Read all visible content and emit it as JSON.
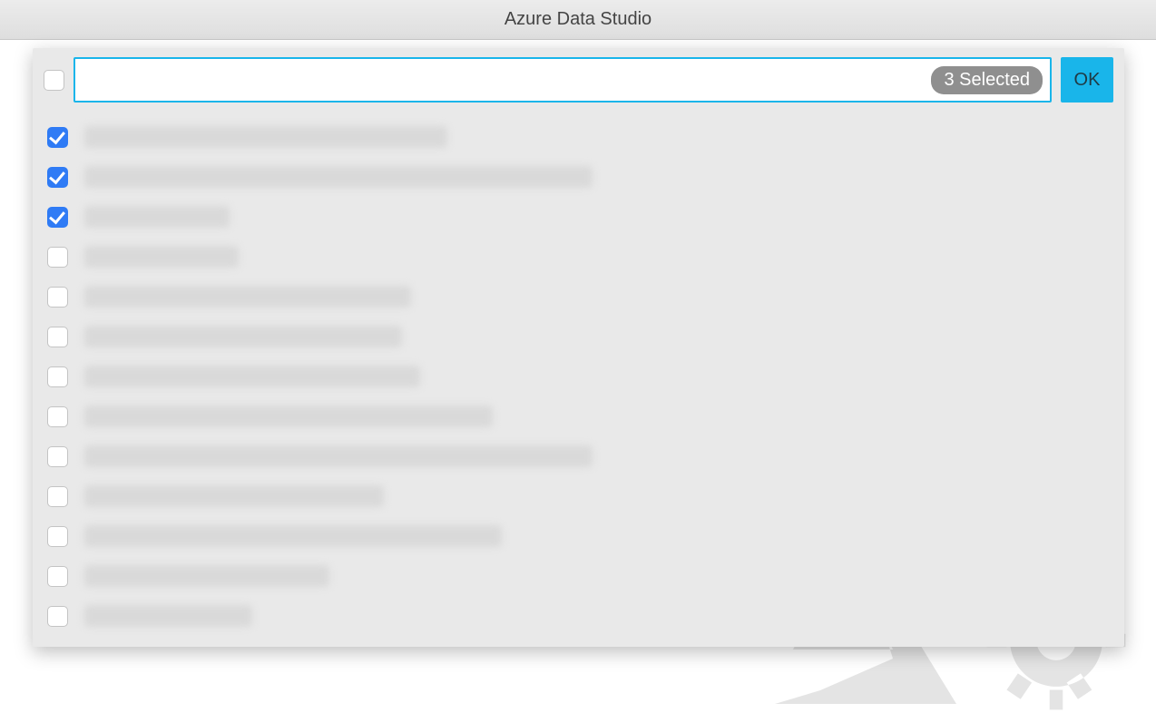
{
  "window": {
    "title": "Azure Data Studio"
  },
  "picker": {
    "search_value": "",
    "search_placeholder": "",
    "selected_badge": "3 Selected",
    "ok_label": "OK",
    "select_all_checked": false,
    "items": [
      {
        "checked": true,
        "label_width": 400
      },
      {
        "checked": true,
        "label_width": 560
      },
      {
        "checked": true,
        "label_width": 160
      },
      {
        "checked": false,
        "label_width": 170
      },
      {
        "checked": false,
        "label_width": 360
      },
      {
        "checked": false,
        "label_width": 350
      },
      {
        "checked": false,
        "label_width": 370
      },
      {
        "checked": false,
        "label_width": 450
      },
      {
        "checked": false,
        "label_width": 560
      },
      {
        "checked": false,
        "label_width": 330
      },
      {
        "checked": false,
        "label_width": 460
      },
      {
        "checked": false,
        "label_width": 270
      },
      {
        "checked": false,
        "label_width": 185
      }
    ]
  }
}
